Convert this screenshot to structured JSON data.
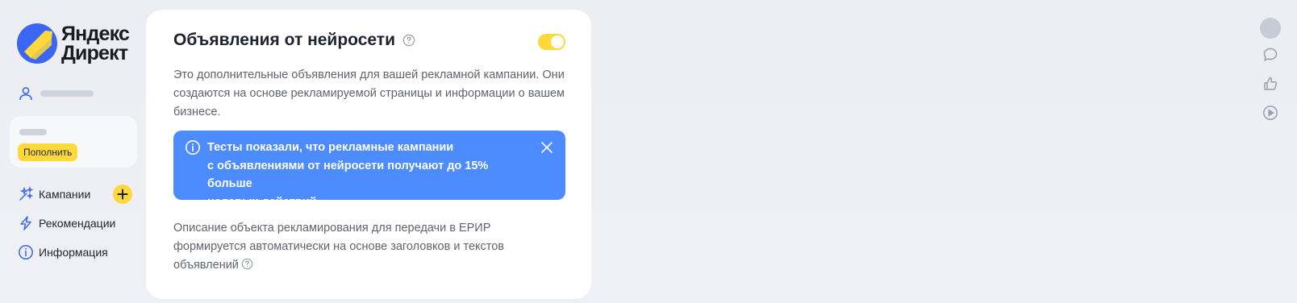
{
  "brand": {
    "line1": "Яндекс",
    "line2": "Директ",
    "colors": {
      "blue": "#3b66f5",
      "yellow": "#ffd83a"
    }
  },
  "sidebar": {
    "user_icon": "user-icon",
    "topup_label": "Пополнить",
    "items": [
      {
        "label": "Кампании",
        "icon": "magic-wand-icon",
        "has_add": true
      },
      {
        "label": "Рекомендации",
        "icon": "lightning-icon"
      },
      {
        "label": "Информация",
        "icon": "info-icon"
      }
    ]
  },
  "card": {
    "title": "Объявления от нейросети",
    "toggle_on": true,
    "description": "Это дополнительные объявления для вашей рекламной кампании. Они создаются на основе рекламируемой страницы и информации о вашем бизнесе.",
    "banner": {
      "lines": [
        "Тесты показали, что рекламные кампании",
        "с объявлениями от нейросети получают до 15% больше",
        "целевых действий"
      ],
      "color": "#4d8cff"
    },
    "erir": {
      "lines": [
        "Описание объекта рекламирования для передачи в ЕРИР",
        "формируется автоматически на основе заголовков и текстов",
        "объявлений"
      ]
    }
  },
  "rail": {
    "icons": [
      "avatar",
      "chat-icon",
      "thumbs-up-icon",
      "play-icon"
    ]
  }
}
